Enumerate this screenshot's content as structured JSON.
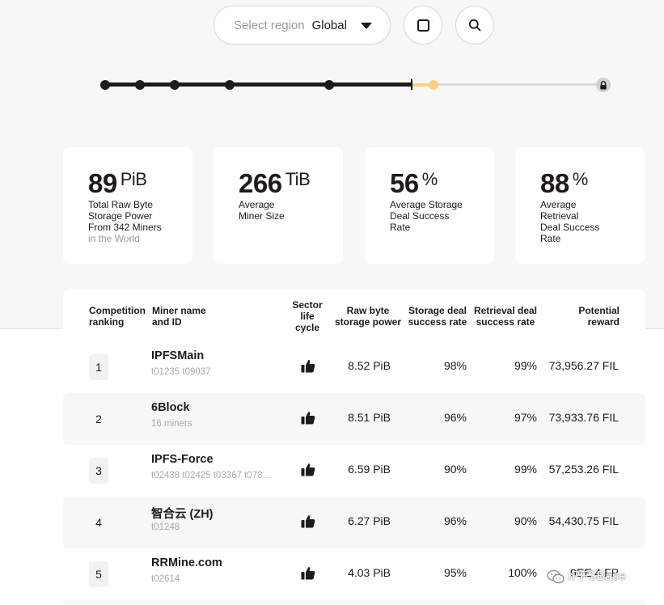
{
  "header": {
    "region_label": "Select region",
    "region_value": "Global",
    "square_button_icon": "square-icon",
    "search_button_icon": "search-icon"
  },
  "timeline": {
    "completed_steps": 6,
    "current_step_color": "#f8d27a",
    "end_icon": "lock-icon"
  },
  "stats": [
    {
      "value": "89",
      "unit": "PiB",
      "desc": [
        "Total Raw Byte",
        "Storage Power",
        "From 342 Miners"
      ],
      "muted": "in the World"
    },
    {
      "value": "266",
      "unit": "TiB",
      "desc": [
        "Average",
        "Miner Size"
      ],
      "muted": ""
    },
    {
      "value": "56",
      "unit": "%",
      "desc": [
        "Average Storage",
        "Deal Success",
        "Rate"
      ],
      "muted": ""
    },
    {
      "value": "88",
      "unit": "%",
      "desc": [
        "Average",
        "Retrieval",
        "Deal Success",
        "Rate"
      ],
      "muted": ""
    }
  ],
  "table": {
    "headers": {
      "ranking": [
        "Competition",
        "ranking"
      ],
      "miner": [
        "Miner name",
        "and ID"
      ],
      "sector": [
        "Sector",
        "life",
        "cycle"
      ],
      "raw": [
        "Raw byte",
        "storage power"
      ],
      "storage": [
        "Storage deal",
        "success rate"
      ],
      "retrieval": [
        "Retrieval deal",
        "success rate"
      ],
      "reward": [
        "Potential",
        "reward"
      ]
    },
    "rows": [
      {
        "rank": "1",
        "name": "IPFSMain",
        "id": "t01235 t09037",
        "raw": "8.52 PiB",
        "storage": "98%",
        "retrieval": "99%",
        "reward": "73,956.27 FIL"
      },
      {
        "rank": "2",
        "name": "6Block",
        "id": "16 miners",
        "raw": "8.51 PiB",
        "storage": "96%",
        "retrieval": "97%",
        "reward": "73,933.76 FIL"
      },
      {
        "rank": "3",
        "name": "IPFS-Force",
        "id": "t02438 t02425 t03367 t078…",
        "raw": "6.59 PiB",
        "storage": "90%",
        "retrieval": "99%",
        "reward": "57,253.26 FIL"
      },
      {
        "rank": "4",
        "name": "智合云 (ZH)",
        "id": "t01248",
        "raw": "6.27 PiB",
        "storage": "96%",
        "retrieval": "90%",
        "reward": "54,430.75 FIL"
      },
      {
        "rank": "5",
        "name": "RRMine.com",
        "id": "t02614",
        "raw": "4.03 PiB",
        "storage": "95%",
        "retrieval": "100%",
        "reward": "9EE 4 FP"
      }
    ]
  },
  "watermark": {
    "text": "IPFSBase",
    "icon": "wechat-icon"
  }
}
